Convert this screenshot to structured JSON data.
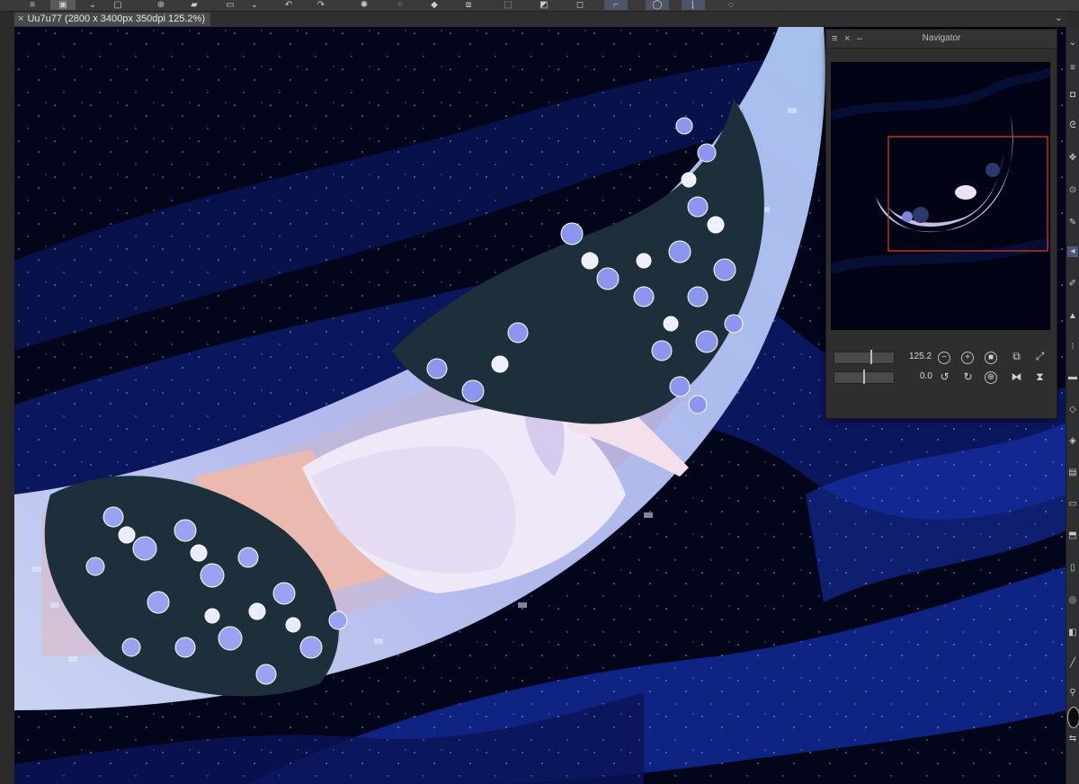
{
  "document_tab": {
    "title": "Uu7u77 (2800 x 3400px 350dpi 125.2%)",
    "close_glyph": "×"
  },
  "navigator": {
    "title": "Navigator",
    "zoom_value": "125.2",
    "rotation_value": "0.0",
    "zoom_slider_position": 0.62,
    "rotation_slider_position": 0.5
  },
  "colors": {
    "accent": "#5b6cc7",
    "canvas_bg": "#03051a",
    "viewport_frame": "#e23b2e"
  },
  "icons": [
    "menu-icon",
    "layer-icon",
    "chevron-down-icon",
    "image-icon",
    "add-icon",
    "eraser-icon",
    "undo-icon",
    "redo-icon",
    "spinner-icon",
    "fill-icon",
    "transform-icon",
    "crop-icon",
    "lasso-icon",
    "speech-icon"
  ]
}
